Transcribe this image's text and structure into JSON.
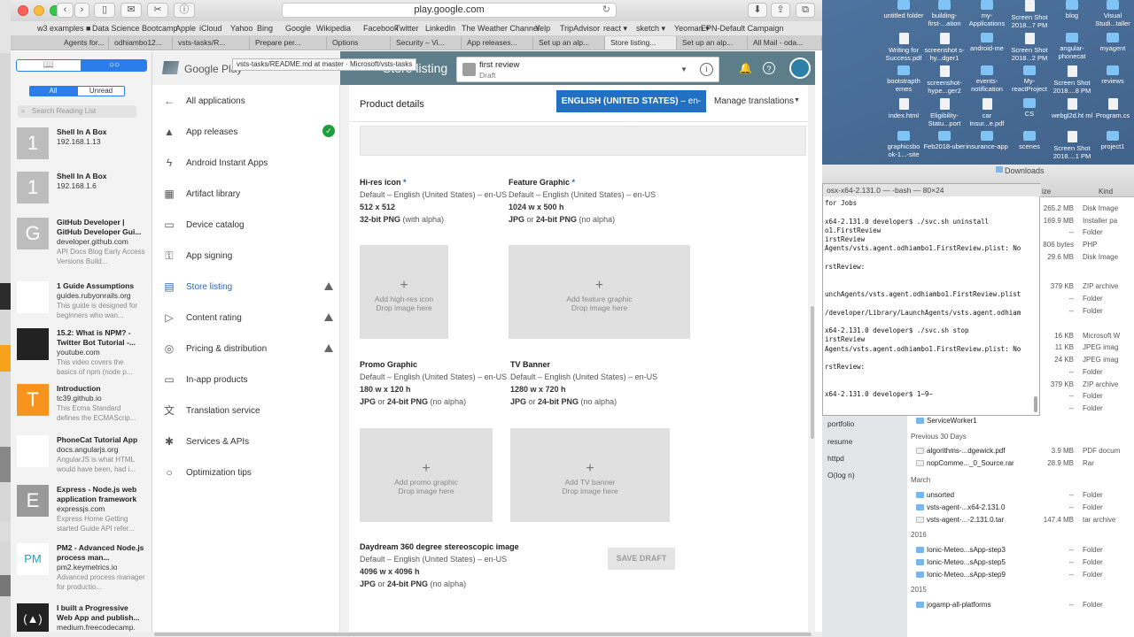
{
  "safari": {
    "url": "play.google.com",
    "bookmarks": [
      "w3 examples ■",
      "Data Science Bootcamp",
      "Apple",
      "iCloud",
      "Yahoo",
      "Bing",
      "Google",
      "Wikipedia",
      "Facebook",
      "Twitter",
      "LinkedIn",
      "The Weather Channel",
      "Yelp",
      "TripAdvisor",
      "react ▾",
      "sketch ▾",
      "Yeoman ▾",
      "EPN-Default Campaign"
    ],
    "tabs": [
      "Agents for...",
      "odhiambo12...",
      "vsts-tasks/R...",
      "Prepare per...",
      "Options",
      "Security – Vi...",
      "App releases...",
      "Set up an alp...",
      "Store listing...",
      "Set up an alp...",
      "All Mail - oda..."
    ],
    "tooltip": "vsts-tasks/README.md at master · Microsoft/vsts-tasks"
  },
  "reading_list": {
    "filter_all": "All",
    "filter_unread": "Unread",
    "search_placeholder": "Search Reading List",
    "items": [
      {
        "thumb": "1",
        "title": "Shell In A Box",
        "sub": "192.168.1.13",
        "desc": ""
      },
      {
        "thumb": "1",
        "title": "Shell In A Box",
        "sub": "192.168.1.6",
        "desc": ""
      },
      {
        "thumb": "G",
        "title": "GitHub Developer | GitHub Developer Gui...",
        "sub": "developer.github.com",
        "desc": "API Docs Blog Early Access Versions Build..."
      },
      {
        "thumb": "",
        "title": "1 Guide Assumptions",
        "sub": "guides.rubyonrails.org",
        "desc": "This guide is designed for beginners who wan..."
      },
      {
        "thumb": "",
        "title": "15.2: What is NPM? - Twitter Bot Tutorial -...",
        "sub": "youtube.com",
        "desc": "This video covers the basics of npm (node p..."
      },
      {
        "thumb": "T",
        "title": "Introduction",
        "sub": "tc39.github.io",
        "desc": "This Ecma Standard defines the ECMAScrip..."
      },
      {
        "thumb": "",
        "title": "PhoneCat Tutorial App",
        "sub": "docs.angularjs.org",
        "desc": "AngularJS is what HTML would have been, had i..."
      },
      {
        "thumb": "E",
        "title": "Express - Node.js web application framework",
        "sub": "expressjs.com",
        "desc": "Express Home Getting started Guide API refer..."
      },
      {
        "thumb": "PM",
        "title": "PM2 - Advanced Node.js process man...",
        "sub": "pm2.keymetrics.io",
        "desc": "Advanced process manager for productio..."
      },
      {
        "thumb": "(▲)",
        "title": "I built a Progressive Web App and publish...",
        "sub": "medium.freecodecamp.",
        "desc": ""
      }
    ]
  },
  "play": {
    "brand": "Google Play",
    "app_name": "first review",
    "app_status": "Draft",
    "page_heading": "Store listing",
    "nav": [
      {
        "label": "All applications",
        "icon": "←"
      },
      {
        "label": "App releases",
        "icon": "▲"
      },
      {
        "label": "Android Instant Apps",
        "icon": "ϟ"
      },
      {
        "label": "Artifact library",
        "icon": "▦"
      },
      {
        "label": "Device catalog",
        "icon": "▭"
      },
      {
        "label": "App signing",
        "icon": "⚿"
      },
      {
        "label": "Store listing",
        "icon": "▤"
      },
      {
        "label": "Content rating",
        "icon": "▷"
      },
      {
        "label": "Pricing & distribution",
        "icon": "◎"
      },
      {
        "label": "In-app products",
        "icon": "▭"
      },
      {
        "label": "Translation service",
        "icon": "文"
      },
      {
        "label": "Services & APIs",
        "icon": "✱"
      },
      {
        "label": "Optimization tips",
        "icon": "○"
      }
    ],
    "product_details": "Product details",
    "language_button": "ENGLISH (UNITED STATES)",
    "language_code": "– en-US",
    "manage_translations": "Manage translations",
    "save_draft": "SAVE DRAFT",
    "graphics": {
      "hires_title": "Hi-res icon",
      "hires_lang": "Default – English (United States) – en-US",
      "hires_size": "512 x 512",
      "hires_fmt_bold": "32-bit PNG",
      "hires_fmt_rest": " (with alpha)",
      "hires_drop1": "Add high-res icon",
      "hires_drop2": "Drop image here",
      "feature_title": "Feature Graphic",
      "feature_lang": "Default – English (United States) – en-US",
      "feature_size": "1024 w x 500 h",
      "feature_fmt_a": "JPG",
      "feature_fmt_or": " or ",
      "feature_fmt_b": "24-bit PNG",
      "feature_fmt_rest": " (no alpha)",
      "feature_drop1": "Add feature graphic",
      "feature_drop2": "Drop image here",
      "promo_title": "Promo Graphic",
      "promo_lang": "Default – English (United States) – en-US",
      "promo_size": "180 w x 120 h",
      "promo_drop1": "Add promo graphic",
      "promo_drop2": "Drop image here",
      "tv_title": "TV Banner",
      "tv_lang": "Default – English (United States) – en-US",
      "tv_size": "1280 w x 720 h",
      "tv_drop1": "Add TV banner",
      "tv_drop2": "Drop image here",
      "daydream_title": "Daydream 360 degree stereoscopic image",
      "daydream_lang": "Default – English (United States) – en-US",
      "daydream_size": "4096 w x 4096 h"
    }
  },
  "desktop_icons": [
    "untitled folder",
    "building-first-...ation",
    "my-Applications",
    "Screen Shot 2018...7 PM",
    "blog",
    "Visual Studi...taller",
    "Writing for Success.pdf",
    "screenshot s-hy...dger1",
    "android-me",
    "Screen Shot 2018...2 PM",
    "angular-phonecat",
    "myagent",
    "bootstrapth emes",
    "screenshot-hype...ger2",
    "events-notification",
    "My-reactProject",
    "Screen Shot 2018....8 PM",
    "reviews",
    "index.html",
    "Eligibility-Statu...port",
    "car insur...e.pdf",
    "CS",
    "webgl2d.ht ml",
    "Program.cs",
    "graphicsbo ok-1...-site",
    "Feb2018-uber",
    "insurance-app",
    "scenes",
    "Screen Shot 2018....1 PM",
    "project1"
  ],
  "terminal": {
    "title": "osx-x64-2.131.0 — -bash — 80×24",
    "lines": [
      "for Jobs",
      "",
      "x64-2.131.0 developer$ ./svc.sh uninstall",
      "o1.FirstReview",
      "irstReview",
      "Agents/vsts.agent.odhiambo1.FirstReview.plist: No",
      "",
      "rstReview:",
      "",
      "",
      "unchAgents/vsts.agent.odhiambo1.FirstReview.plist",
      "",
      "/developer/Library/LaunchAgents/vsts.agent.odhiam",
      "",
      "x64-2.131.0 developer$ ./svc.sh stop",
      "irstReview",
      "Agents/vsts.agent.odhiambo1.FirstReview.plist: No",
      "",
      "rstReview:",
      "",
      "",
      "x64-2.131.0 developer$ 1~9~"
    ]
  },
  "finder": {
    "title": "Downloads",
    "col_size": "ize",
    "col_kind": "Kind",
    "sidebar": [
      "Developer's iMac",
      "Remote Disc",
      "Visual Studio for...",
      "ed",
      "desktop-jjcbcci",
      "fasonahome",
      "335week2Discussion",
      "Virtual macOS 10.13",
      "freeBootstrapThemes",
      "portfolio",
      "resume",
      "httpd",
      "O(log n)"
    ],
    "top_rows": [
      {
        "size": "265.2 MB",
        "kind": "Disk Image"
      },
      {
        "size": "169.9 MB",
        "kind": "Installer pa"
      },
      {
        "size": "--",
        "kind": "Folder"
      },
      {
        "size": "806 bytes",
        "kind": "PHP"
      },
      {
        "size": "29.6 MB",
        "kind": "Disk Image"
      },
      {
        "size": "379 KB",
        "kind": "ZIP archive"
      },
      {
        "size": "--",
        "kind": "Folder"
      },
      {
        "size": "--",
        "kind": "Folder"
      },
      {
        "size": "16 KB",
        "kind": "Microsoft W"
      },
      {
        "size": "11 KB",
        "kind": "JPEG imag"
      },
      {
        "size": "24 KB",
        "kind": "JPEG imag"
      },
      {
        "size": "--",
        "kind": "Folder"
      },
      {
        "size": "379 KB",
        "kind": "ZIP archive"
      },
      {
        "size": "--",
        "kind": "Folder"
      },
      {
        "size": "--",
        "kind": "Folder"
      }
    ],
    "serviceworker": "ServiceWorker1",
    "prev30": "Previous 30 Days",
    "prev30_rows": [
      {
        "name": "algorithms-...dgewick.pdf",
        "size": "3.9 MB",
        "kind": "PDF docum"
      },
      {
        "name": "nopComme..._0_Source.rar",
        "size": "28.9 MB",
        "kind": "Rar"
      }
    ],
    "march": "March",
    "march_rows": [
      {
        "name": "unsorted",
        "size": "--",
        "kind": "Folder"
      },
      {
        "name": "vsts-agent-...x64-2.131.0",
        "size": "--",
        "kind": "Folder"
      },
      {
        "name": "vsts-agent-...-2.131.0.tar",
        "size": "147.4 MB",
        "kind": "tar archive"
      }
    ],
    "y2016": "2016",
    "y2016_rows": [
      {
        "name": "Ionic-Meteo...sApp-step3",
        "size": "--",
        "kind": "Folder"
      },
      {
        "name": "Ionic-Meteo...sApp-step5",
        "size": "--",
        "kind": "Folder"
      },
      {
        "name": "Ionic-Meteo...sApp-step9",
        "size": "--",
        "kind": "Folder"
      }
    ],
    "y2015": "2015",
    "y2015_rows": [
      {
        "name": "jogamp-all-platforms",
        "size": "--",
        "kind": "Folder"
      }
    ]
  }
}
